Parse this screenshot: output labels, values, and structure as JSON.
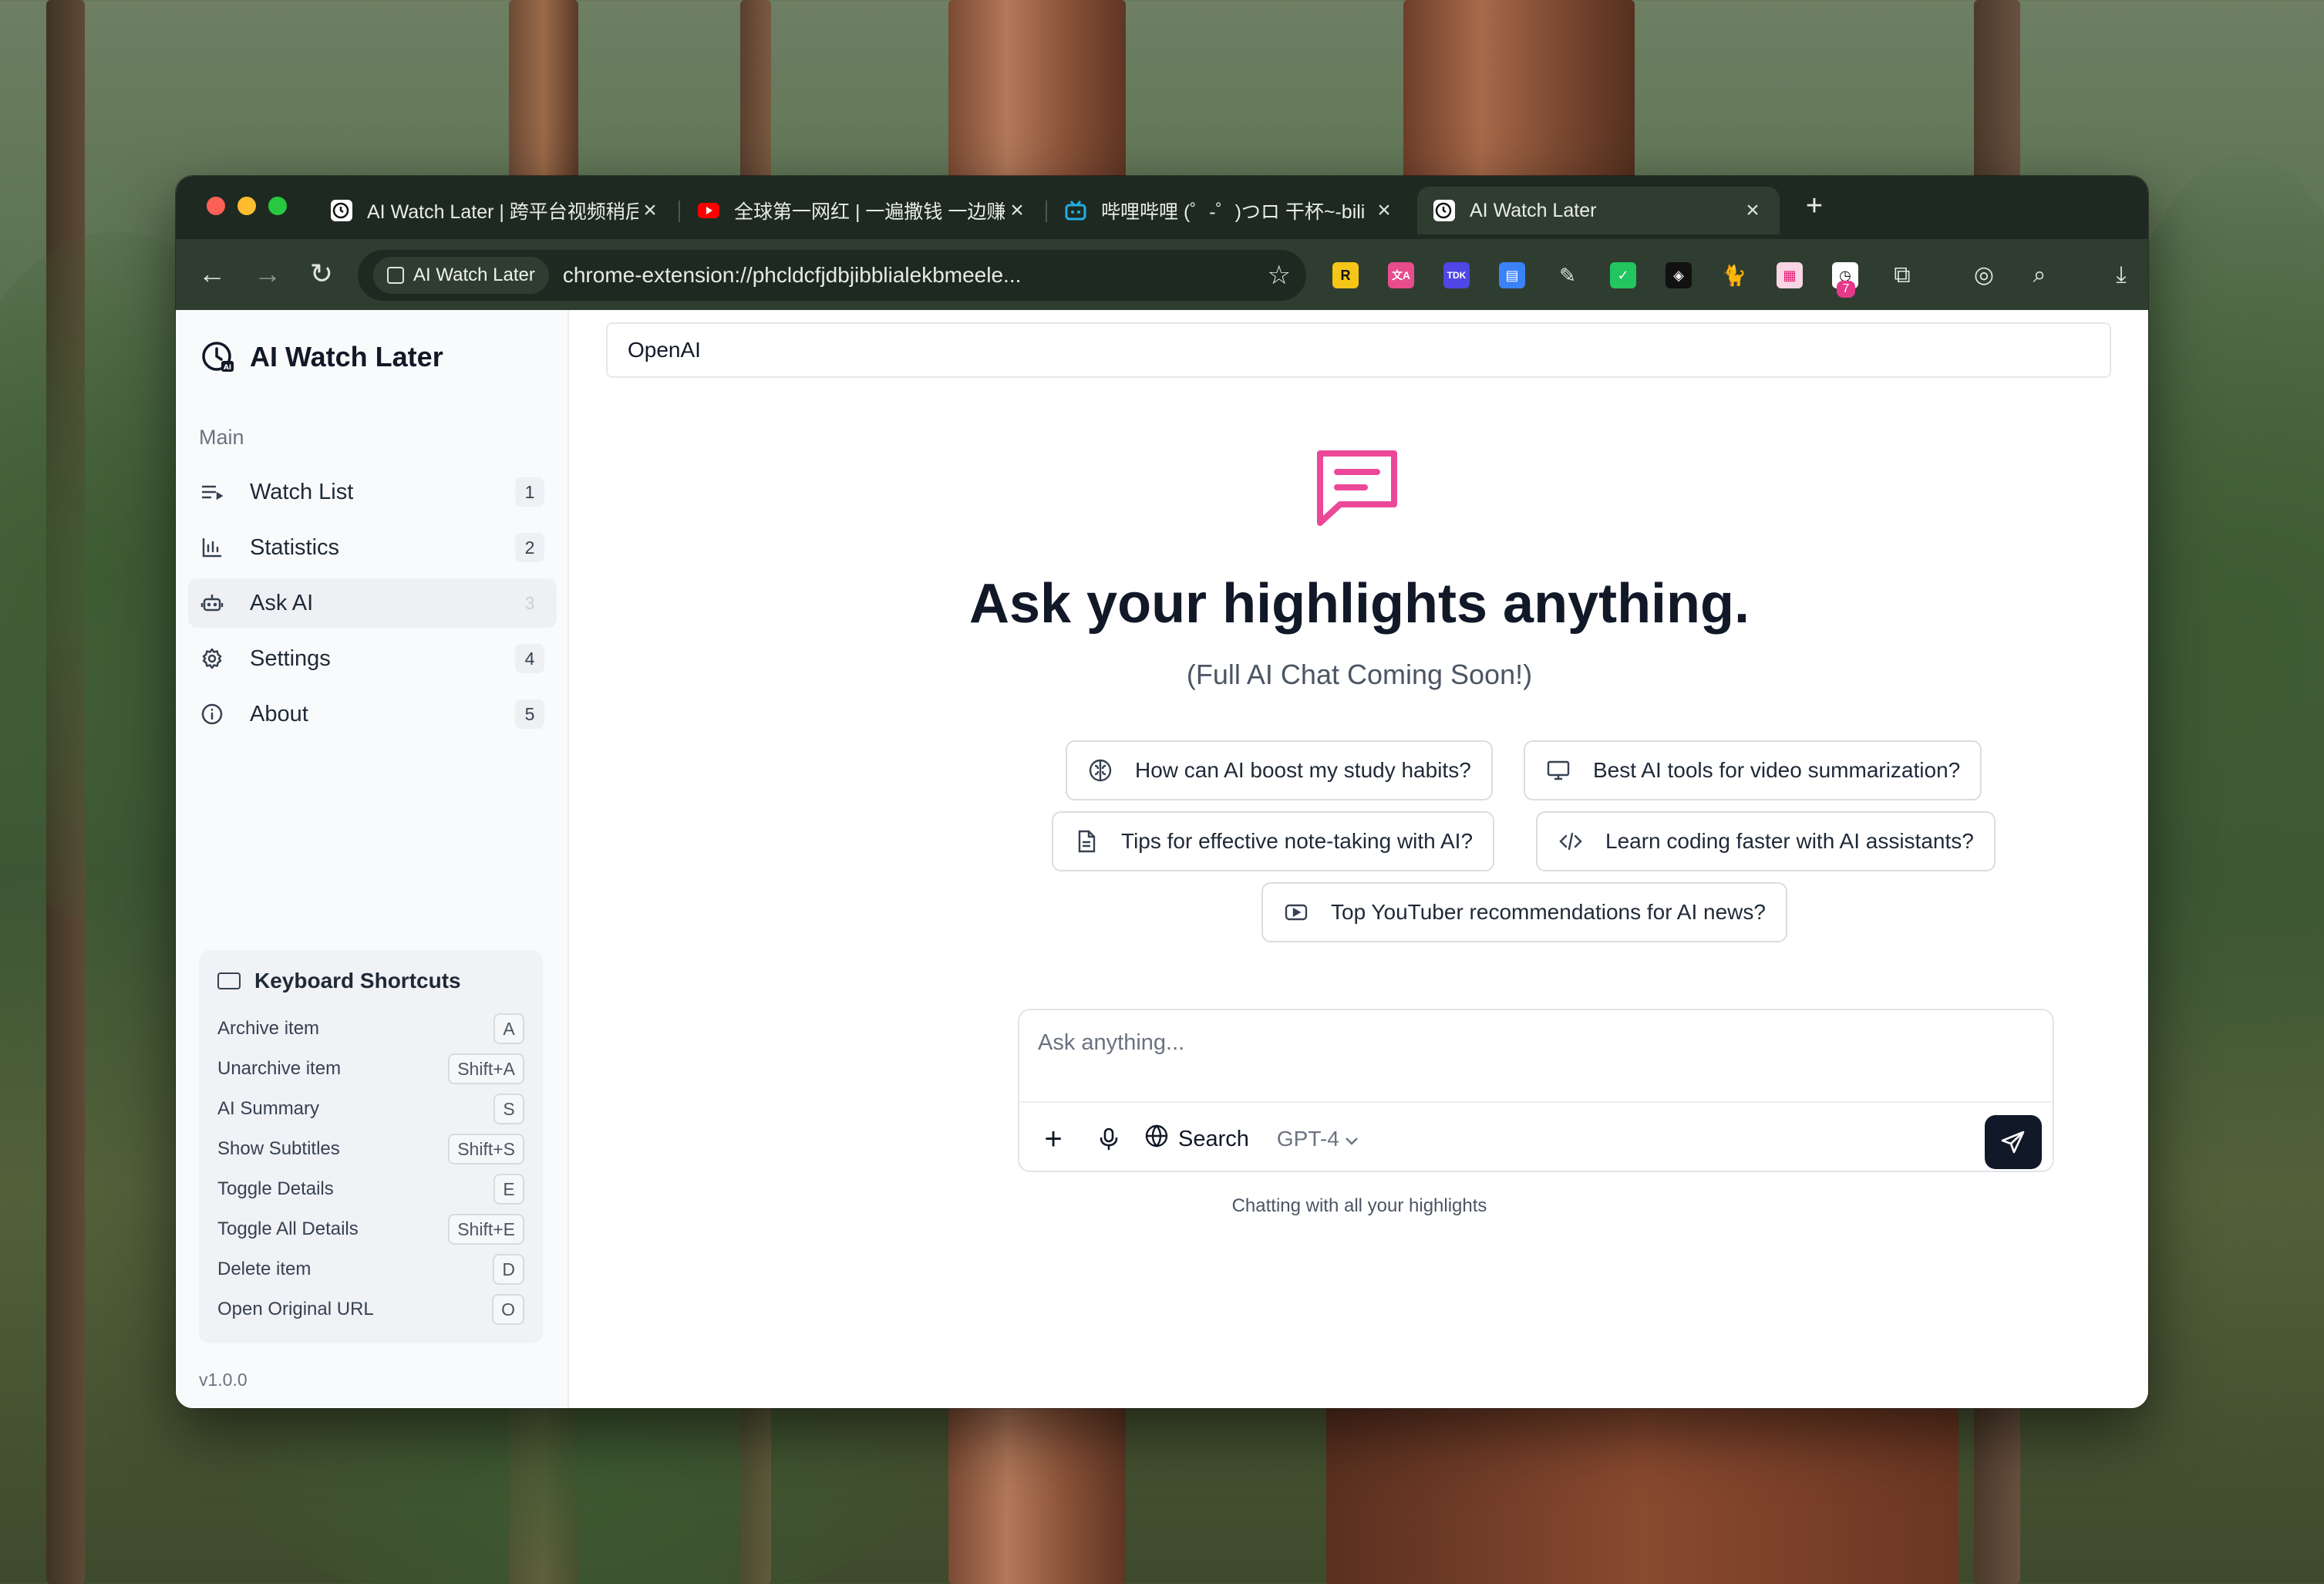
{
  "browser": {
    "tabs": [
      {
        "title": "AI Watch Later | 跨平台视频稍后",
        "active": false,
        "icon": "clock-icon"
      },
      {
        "title": "全球第一网红 | 一遍撒钱 一边赚",
        "active": false,
        "icon": "youtube-icon"
      },
      {
        "title": "哔哩哔哩 (゜-゜)つロ 干杯~-bili",
        "active": false,
        "icon": "bilibili-icon"
      },
      {
        "title": "AI Watch Later",
        "active": true,
        "icon": "clock-icon"
      }
    ],
    "close_glyph": "×",
    "new_tab_glyph": "+",
    "site_chip": "AI Watch Later",
    "url": "chrome-extension://phcldcfjdbjibblialekbmeele...",
    "extension_badge": "7"
  },
  "app": {
    "title": "AI Watch Later",
    "section_label": "Main",
    "nav": [
      {
        "label": "Watch List",
        "count": "1",
        "icon": "list-icon"
      },
      {
        "label": "Statistics",
        "count": "2",
        "icon": "bar-chart-icon"
      },
      {
        "label": "Ask AI",
        "count": "3",
        "icon": "bot-icon",
        "active": true
      },
      {
        "label": "Settings",
        "count": "4",
        "icon": "gear-icon"
      },
      {
        "label": "About",
        "count": "5",
        "icon": "info-icon"
      }
    ],
    "shortcuts": {
      "title": "Keyboard Shortcuts",
      "items": [
        {
          "label": "Archive item",
          "key": "A"
        },
        {
          "label": "Unarchive item",
          "key": "Shift+A"
        },
        {
          "label": "AI Summary",
          "key": "S"
        },
        {
          "label": "Show Subtitles",
          "key": "Shift+S"
        },
        {
          "label": "Toggle Details",
          "key": "E"
        },
        {
          "label": "Toggle All Details",
          "key": "Shift+E"
        },
        {
          "label": "Delete item",
          "key": "D"
        },
        {
          "label": "Open Original URL",
          "key": "O"
        }
      ]
    },
    "version": "v1.0.0"
  },
  "main": {
    "topic_value": "OpenAI",
    "headline": "Ask your highlights anything.",
    "subline": "(Full AI Chat Coming Soon!)",
    "suggestions": [
      {
        "label": "How can AI boost my study habits?",
        "icon": "brain-icon"
      },
      {
        "label": "Best AI tools for video summarization?",
        "icon": "monitor-icon"
      },
      {
        "label": "Tips for effective note-taking with AI?",
        "icon": "file-text-icon"
      },
      {
        "label": "Learn coding faster with AI assistants?",
        "icon": "code-icon"
      },
      {
        "label": "Top YouTuber recommendations for AI news?",
        "icon": "video-icon"
      }
    ],
    "chat": {
      "placeholder": "Ask anything...",
      "plus_glyph": "+",
      "search_label": "Search",
      "model": "GPT-4",
      "caption": "Chatting with all your highlights"
    }
  },
  "colors": {
    "accent_pink": "#ec4899",
    "tab_bar": "#1e2a21",
    "toolbar": "#2f3d31",
    "send_button": "#111827"
  }
}
